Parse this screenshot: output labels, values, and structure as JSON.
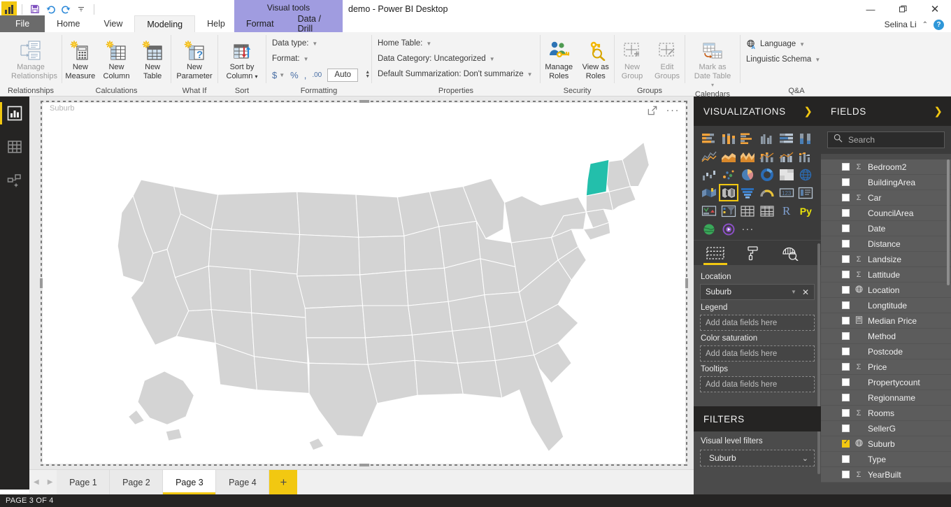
{
  "titlebar": {
    "app_title": "demo - Power BI Desktop",
    "contextual_banner": "Visual tools",
    "account_name": "Selina Li",
    "quick_access": [
      {
        "name": "save",
        "glyph": "💾"
      },
      {
        "name": "undo",
        "glyph": "↶"
      },
      {
        "name": "redo",
        "glyph": "↷"
      },
      {
        "name": "customize",
        "glyph": "⌵"
      }
    ],
    "window_controls": {
      "minimize": "—",
      "maximize": "❐",
      "close": "✕"
    },
    "help_badge": "?"
  },
  "ribbon_tabs": {
    "file": "File",
    "main": [
      "Home",
      "View",
      "Modeling",
      "Help"
    ],
    "contextual": [
      "Format",
      "Data / Drill"
    ],
    "active": "Modeling"
  },
  "ribbon": {
    "groups": [
      {
        "name": "Relationships",
        "label": "Relationships",
        "buttons": [
          {
            "label": "Manage\nRelationships",
            "label_line1": "Manage",
            "label_line2": "Relationships",
            "icon": "manage-relationships-icon",
            "disabled": true
          }
        ]
      },
      {
        "name": "Calculations",
        "label": "Calculations",
        "buttons": [
          {
            "label_line1": "New",
            "label_line2": "Measure",
            "icon": "new-measure-icon"
          },
          {
            "label_line1": "New",
            "label_line2": "Column",
            "icon": "new-column-icon"
          },
          {
            "label_line1": "New",
            "label_line2": "Table",
            "icon": "new-table-icon"
          }
        ]
      },
      {
        "name": "WhatIf",
        "label": "What If",
        "buttons": [
          {
            "label_line1": "New",
            "label_line2": "Parameter",
            "icon": "new-parameter-icon"
          }
        ]
      },
      {
        "name": "Sort",
        "label": "Sort",
        "buttons": [
          {
            "label_line1": "Sort by",
            "label_line2": "Column",
            "icon": "sort-by-column-icon",
            "has_caret": true
          }
        ]
      },
      {
        "name": "Formatting",
        "label": "Formatting",
        "rows": [
          {
            "text": "Data type:",
            "has_dropdown": true
          },
          {
            "text": "Format:",
            "has_dropdown": true
          }
        ],
        "format_buttons": [
          {
            "name": "currency",
            "glyph": "$",
            "has_caret": true
          },
          {
            "name": "percent",
            "glyph": "%"
          },
          {
            "name": "thousands-separator",
            "glyph": ","
          },
          {
            "name": "decimal-places",
            "glyph": ".00"
          }
        ],
        "decimal_value": "Auto"
      },
      {
        "name": "Properties",
        "label": "Properties",
        "rows": [
          {
            "text": "Home Table:",
            "has_dropdown": true
          },
          {
            "text": "Data Category: Uncategorized",
            "has_dropdown": true
          },
          {
            "text": "Default Summarization: Don't summarize",
            "has_dropdown": true
          }
        ]
      },
      {
        "name": "Security",
        "label": "Security",
        "buttons": [
          {
            "label_line1": "Manage",
            "label_line2": "Roles",
            "icon": "manage-roles-icon"
          },
          {
            "label_line1": "View as",
            "label_line2": "Roles",
            "icon": "view-as-roles-icon"
          }
        ]
      },
      {
        "name": "Groups",
        "label": "Groups",
        "buttons": [
          {
            "label_line1": "New",
            "label_line2": "Group",
            "icon": "new-group-icon",
            "disabled": true
          },
          {
            "label_line1": "Edit",
            "label_line2": "Groups",
            "icon": "edit-groups-icon",
            "disabled": true
          }
        ]
      },
      {
        "name": "Calendars",
        "label": "Calendars",
        "buttons": [
          {
            "label_line1": "Mark as",
            "label_line2": "Date Table",
            "icon": "mark-as-date-table-icon",
            "disabled": true,
            "has_caret": true
          }
        ]
      },
      {
        "name": "QandA",
        "label": "Q&A",
        "rows": [
          {
            "text": "Language",
            "has_dropdown": true,
            "icon": "language-icon"
          },
          {
            "text": "Linguistic Schema",
            "has_dropdown": true
          }
        ]
      }
    ]
  },
  "left_rail": {
    "items": [
      {
        "name": "report-view",
        "icon": "report-bar-chart-icon",
        "active": true
      },
      {
        "name": "data-view",
        "icon": "data-grid-icon",
        "active": false
      },
      {
        "name": "model-view",
        "icon": "model-relationships-icon",
        "active": false
      }
    ]
  },
  "canvas": {
    "visual_title": "Suburb",
    "focus_mode_icon": "focus-mode-icon",
    "more_options_icon": "more-options-icon"
  },
  "chart_data": {
    "type": "map",
    "title": "Suburb",
    "map_region": "United States",
    "highlighted_regions": [
      {
        "name": "Vermont",
        "color": "#23BFAB"
      }
    ],
    "base_region_color": "#d4d4d4",
    "border_color": "#ffffff",
    "legend": []
  },
  "page_tabs": {
    "prev_icon": "chevron-left-icon",
    "next_icon": "chevron-right-icon",
    "tabs": [
      "Page 1",
      "Page 2",
      "Page 3",
      "Page 4"
    ],
    "active": "Page 3",
    "add_label": "+"
  },
  "status_bar": {
    "text": "PAGE 3 OF 4"
  },
  "visualizations": {
    "header": "VISUALIZATIONS",
    "collapse_icon": "chevron-right-icon",
    "icons": [
      "stacked-bar-chart-icon",
      "stacked-column-chart-icon",
      "clustered-bar-chart-icon",
      "clustered-column-chart-icon",
      "100-stacked-bar-chart-icon",
      "100-stacked-column-chart-icon",
      "line-chart-icon",
      "area-chart-icon",
      "stacked-area-chart-icon",
      "line-stacked-column-chart-icon",
      "line-clustered-column-chart-icon",
      "ribbon-chart-icon",
      "waterfall-chart-icon",
      "scatter-chart-icon",
      "pie-chart-icon",
      "donut-chart-icon",
      "treemap-icon",
      "map-icon",
      "filled-map-icon",
      "shape-map-icon",
      "funnel-chart-icon",
      "gauge-chart-icon",
      "card-icon",
      "multi-row-card-icon",
      "kpi-icon",
      "slicer-icon",
      "table-icon",
      "matrix-icon",
      "r-script-visual-icon",
      "python-visual-icon",
      "arcgis-map-icon",
      "powerapps-visual-icon"
    ],
    "selected_icon": "filled-map-icon",
    "more_icon": "more-visuals-icon",
    "pane_tabs": [
      {
        "name": "fields-tab",
        "icon": "fields-tab-icon",
        "active": true
      },
      {
        "name": "format-tab",
        "icon": "paint-roller-icon",
        "active": false
      },
      {
        "name": "analytics-tab",
        "icon": "analytics-magnifier-icon",
        "active": false
      }
    ],
    "wells": [
      {
        "label": "Location",
        "value": "Suburb",
        "filled": true
      },
      {
        "label": "Legend",
        "placeholder": "Add data fields here",
        "filled": false
      },
      {
        "label": "Color saturation",
        "placeholder": "Add data fields here",
        "filled": false
      },
      {
        "label": "Tooltips",
        "placeholder": "Add data fields here",
        "filled": false
      }
    ]
  },
  "filters": {
    "header": "FILTERS",
    "subtitle": "Visual level filters",
    "items": [
      {
        "name": "Suburb",
        "expand_icon": "chevron-down-icon"
      }
    ]
  },
  "fields": {
    "header": "FIELDS",
    "collapse_icon": "chevron-right-icon",
    "search_placeholder": "Search",
    "search_icon": "search-icon",
    "items": [
      {
        "name": "Bedroom2",
        "checked": false,
        "type": "sum"
      },
      {
        "name": "BuildingArea",
        "checked": false,
        "type": "none"
      },
      {
        "name": "Car",
        "checked": false,
        "type": "sum"
      },
      {
        "name": "CouncilArea",
        "checked": false,
        "type": "none"
      },
      {
        "name": "Date",
        "checked": false,
        "type": "none"
      },
      {
        "name": "Distance",
        "checked": false,
        "type": "none"
      },
      {
        "name": "Landsize",
        "checked": false,
        "type": "sum"
      },
      {
        "name": "Lattitude",
        "checked": false,
        "type": "sum"
      },
      {
        "name": "Location",
        "checked": false,
        "type": "geo"
      },
      {
        "name": "Longtitude",
        "checked": false,
        "type": "none"
      },
      {
        "name": "Median Price",
        "checked": false,
        "type": "measure"
      },
      {
        "name": "Method",
        "checked": false,
        "type": "none"
      },
      {
        "name": "Postcode",
        "checked": false,
        "type": "none"
      },
      {
        "name": "Price",
        "checked": false,
        "type": "sum"
      },
      {
        "name": "Propertycount",
        "checked": false,
        "type": "none"
      },
      {
        "name": "Regionname",
        "checked": false,
        "type": "none"
      },
      {
        "name": "Rooms",
        "checked": false,
        "type": "sum"
      },
      {
        "name": "SellerG",
        "checked": false,
        "type": "none"
      },
      {
        "name": "Suburb",
        "checked": true,
        "type": "geo"
      },
      {
        "name": "Type",
        "checked": false,
        "type": "none"
      },
      {
        "name": "YearBuilt",
        "checked": false,
        "type": "sum"
      }
    ]
  },
  "colors": {
    "accent_yellow": "#F2C811",
    "highlight_teal": "#23BFAB",
    "pane_dark": "#252423",
    "pane_mid": "#4b4b4b",
    "contextual_purple": "#a09ce0"
  }
}
